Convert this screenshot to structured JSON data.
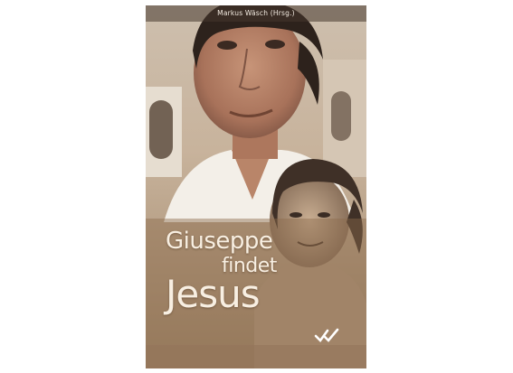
{
  "cover": {
    "author": "Markus Wäsch (Hrsg.)",
    "title_line1": "Giuseppe",
    "title_line2": "findet",
    "title_line3": "Jesus"
  },
  "colors": {
    "background": "#ffffff",
    "cover_tone": "#b79f83",
    "title_text": "#f8efe2"
  },
  "icons": {
    "publisher_logo": "double-checkmark-logo"
  }
}
